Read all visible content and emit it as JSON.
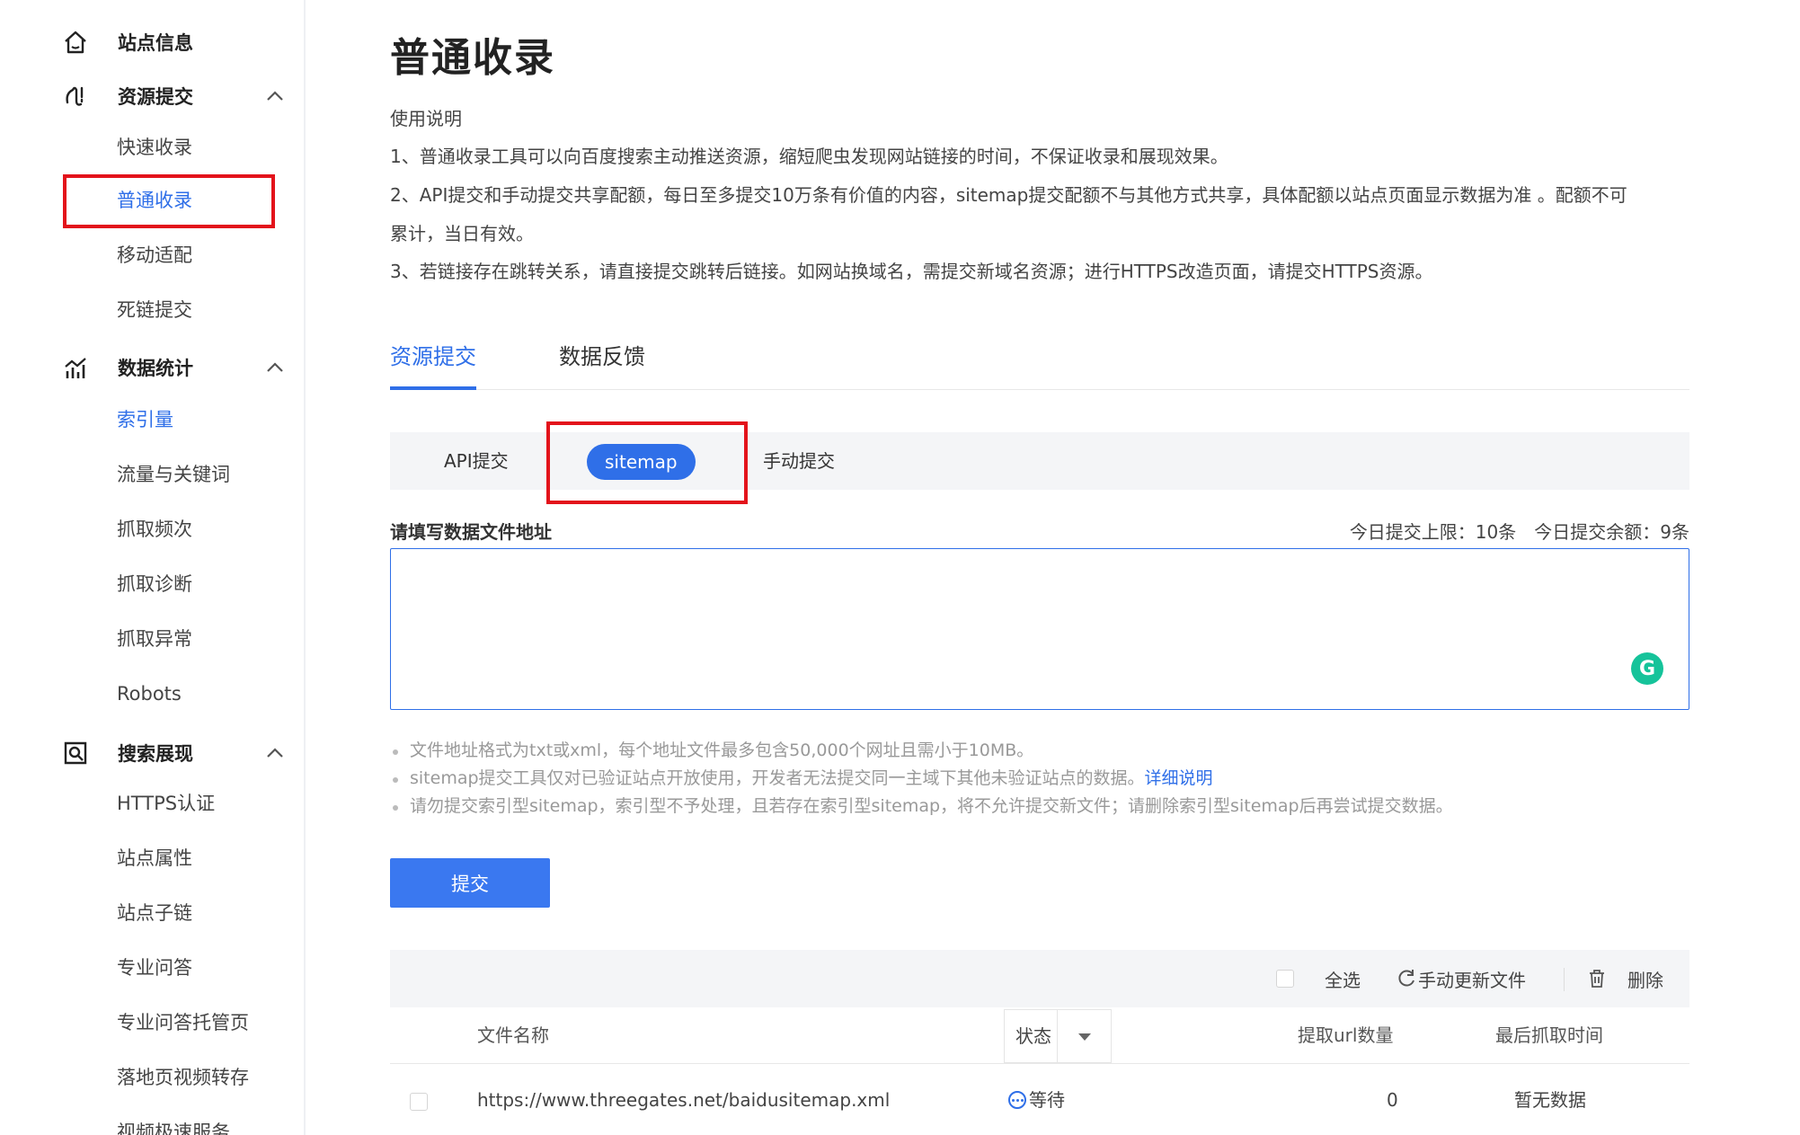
{
  "sidebar": {
    "groups": [
      {
        "label": "站点信息",
        "icon": "home-icon"
      },
      {
        "label": "资源提交",
        "icon": "submit-icon"
      },
      {
        "label": "数据统计",
        "icon": "stats-icon"
      },
      {
        "label": "搜索展现",
        "icon": "search-display-icon"
      }
    ],
    "items": [
      "快速收录",
      "普通收录",
      "移动适配",
      "死链提交",
      "索引量",
      "流量与关键词",
      "抓取频次",
      "抓取诊断",
      "抓取异常",
      "Robots",
      "HTTPS认证",
      "站点属性",
      "站点子链",
      "专业问答",
      "专业问答托管页",
      "落地页视频转存",
      "视频极速服务"
    ]
  },
  "main": {
    "title": "普通收录",
    "instructions": [
      "使用说明",
      "1、普通收录工具可以向百度搜索主动推送资源，缩短爬虫发现网站链接的时间，不保证收录和展现效果。",
      "2、API提交和手动提交共享配额，每日至多提交10万条有价值的内容，sitemap提交配额不与其他方式共享，具体配额以站点页面显示数据为准 。配额不可",
      "累计，当日有效。",
      "3、若链接存在跳转关系，请直接提交跳转后链接。如网站换域名，需提交新域名资源；进行HTTPS改造页面，请提交HTTPS资源。"
    ],
    "tabs": [
      "资源提交",
      "数据反馈"
    ],
    "subtabs": [
      "API提交",
      "sitemap",
      "手动提交"
    ],
    "field_label": "请填写数据文件地址",
    "quota_text": "今日提交上限：10条　今日提交余额：9条",
    "textarea_value": "",
    "grammarly_glyph": "G",
    "notes": [
      "文件地址格式为txt或xml，每个地址文件最多包含50,000个网址且需小于10MB。",
      "sitemap提交工具仅对已验证站点开放使用，开发者无法提交同一主域下其他未验证站点的数据。",
      "请勿提交索引型sitemap，索引型不予处理，且若存在索引型sitemap，将不允许提交新文件；请删除索引型sitemap后再尝试提交数据。"
    ],
    "detail_link": "详细说明",
    "submit_label": "提交",
    "toolbar": {
      "select_all": "全选",
      "refresh": "手动更新文件",
      "delete": "删除"
    },
    "table": {
      "headers": [
        "文件名称",
        "状态",
        "提取url数量",
        "最后抓取时间"
      ],
      "rows": [
        {
          "file": "https://www.threegates.net/baidusitemap.xml",
          "status": "等待",
          "count": "0",
          "last_crawl": "暂无数据"
        }
      ]
    }
  },
  "colors": {
    "accent": "#2f6fe8",
    "highlight": "#e3131b",
    "grammarly": "#15c39a"
  }
}
